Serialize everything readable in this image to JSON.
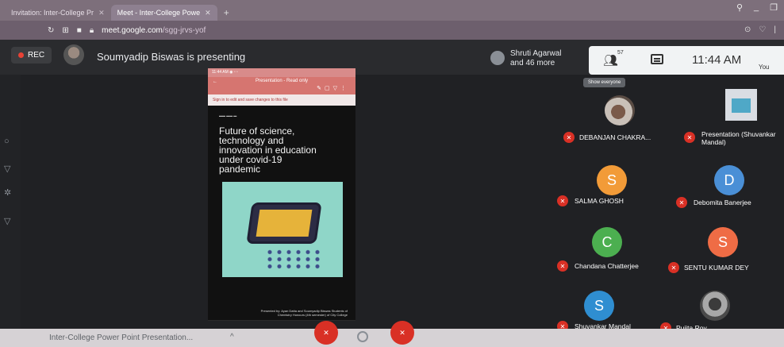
{
  "browser": {
    "tabs": [
      {
        "label": "Invitation: Inter-College Pr",
        "active": false
      },
      {
        "label": "Meet - Inter-College Powe",
        "active": true
      }
    ],
    "new_tab": "+",
    "url_host": "meet.google.com",
    "url_path": "/sgg-jrvs-yof"
  },
  "meet": {
    "rec_label": "REC",
    "presenting_text": "Soumyadip Biswas is presenting",
    "others_line1": "Shruti Agarwal",
    "others_line2": "and 46 more",
    "people_count": "57",
    "people_tooltip": "Show everyone",
    "time": "11:44 AM",
    "you_label": "You"
  },
  "slide": {
    "toolbar_title": "Presentation - Read only",
    "signin_text": "Sign in to edit and save changes to this file",
    "title": "Future of science,\ntechnology and\ninnovation in education\nunder covid-19\npandemic",
    "credit": "Presented by: Ayan Datta and Soumyadip Biswas Students of Chemistry Honours (4th semester) of City College"
  },
  "participants": [
    {
      "name": "DEBANJAN CHAKRA...",
      "type": "photo",
      "avatar_color": "#a0a0a0",
      "initial": ""
    },
    {
      "name": "Presentation (Shuvankar Mandal)",
      "type": "presentation",
      "avatar_color": "#d9dde3",
      "initial": ""
    },
    {
      "name": "SALMA GHOSH",
      "type": "initial",
      "avatar_color": "#f29b38",
      "initial": "S"
    },
    {
      "name": "Debomita Banerjee",
      "type": "initial",
      "avatar_color": "#4a8fd6",
      "initial": "D"
    },
    {
      "name": "Chandana Chatterjee",
      "type": "initial",
      "avatar_color": "#4caf50",
      "initial": "C"
    },
    {
      "name": "SENTU KUMAR DEY",
      "type": "initial",
      "avatar_color": "#ef6c45",
      "initial": "S"
    },
    {
      "name": "Shuvankar Mandal",
      "type": "initial",
      "avatar_color": "#2f8ed1",
      "initial": "S"
    },
    {
      "name": "Pujita Roy",
      "type": "photo2",
      "avatar_color": "#666666",
      "initial": ""
    }
  ],
  "bottom": {
    "meeting_title": "Inter-College Power Point Presentation...",
    "chevron": "^"
  },
  "colors": {
    "mute_red": "#d93025",
    "rec_dot": "#e94235"
  }
}
